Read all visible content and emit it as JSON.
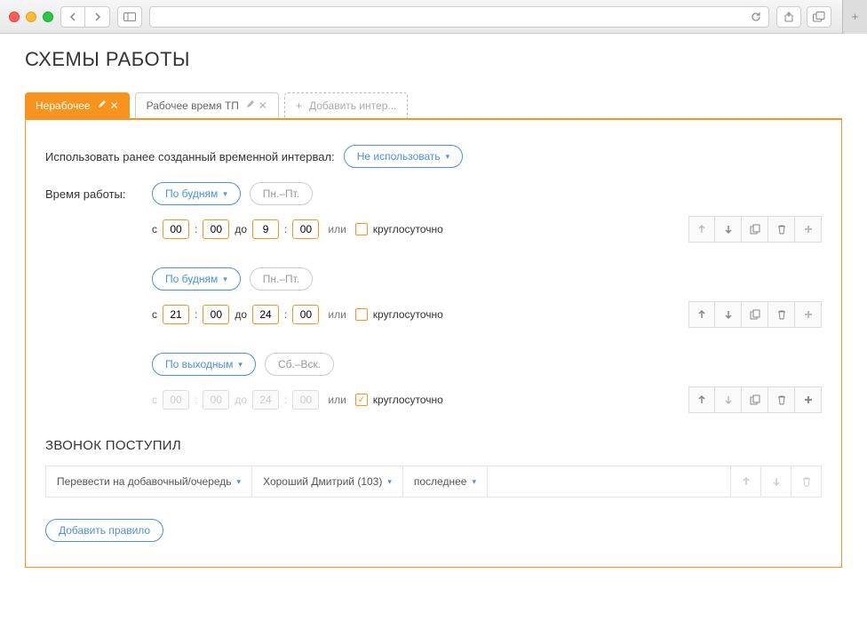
{
  "page_title": "СХЕМЫ РАБОТЫ",
  "tabs": [
    {
      "label": "Нерабочее",
      "active": true
    },
    {
      "label": "Рабочее время ТП",
      "active": false
    },
    {
      "label": "Добавить интер...",
      "add": true
    }
  ],
  "use_prev_label": "Использовать ранее созданный временной интервал:",
  "use_prev_value": "Не использовать",
  "work_time_label": "Время работы:",
  "from_label": "с",
  "to_label": "до",
  "or_label": "или",
  "round_clock_label": "круглосуточно",
  "weekday_selector": "По будням",
  "weekend_selector": "По выходным",
  "weekdays_short": "Пн.–Пт.",
  "weekend_short": "Сб.–Вск.",
  "blocks": [
    {
      "selector": "weekday",
      "from_h": "00",
      "from_m": "00",
      "to_h": "9",
      "to_m": "00",
      "round": false,
      "disabled": false
    },
    {
      "selector": "weekday",
      "from_h": "21",
      "from_m": "00",
      "to_h": "24",
      "to_m": "00",
      "round": false,
      "disabled": false
    },
    {
      "selector": "weekend",
      "from_h": "00",
      "from_m": "00",
      "to_h": "24",
      "to_m": "00",
      "round": true,
      "disabled": true
    }
  ],
  "call_section_title": "ЗВОНОК ПОСТУПИЛ",
  "rule": {
    "action": "Перевести на добавочный/очередь",
    "target": "Хороший Дмитрий (103)",
    "order": "последнее"
  },
  "add_rule_label": "Добавить правило"
}
